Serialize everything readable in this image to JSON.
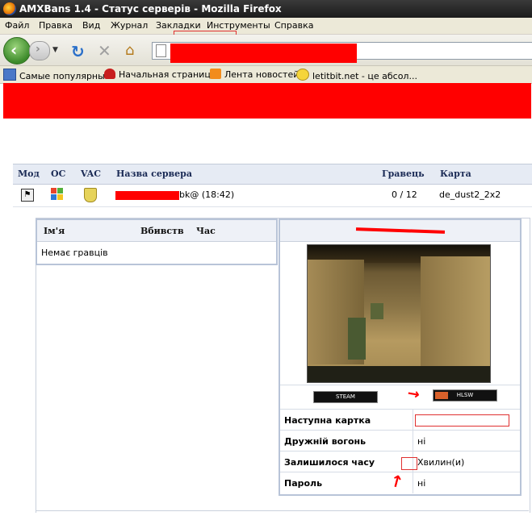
{
  "window": {
    "title": "AMXBans 1.4 - Статус серверів - Mozilla Firefox"
  },
  "menu": [
    {
      "label": "Файл"
    },
    {
      "label": "Правка"
    },
    {
      "label": "Вид"
    },
    {
      "label": "Журнал"
    },
    {
      "label": "Закладки"
    },
    {
      "label": "Инструменты"
    },
    {
      "label": "Справка"
    }
  ],
  "bookmarks": [
    {
      "label": "Самые популярные",
      "icon": "bookmark-folder-icon"
    },
    {
      "label": "Начальная страница",
      "icon": "redhat-icon"
    },
    {
      "label": "Лента новостей",
      "icon": "rss-icon"
    },
    {
      "label": "letitbit.net - це абсол...",
      "icon": "smiley-icon"
    }
  ],
  "server_table": {
    "headers": {
      "mod": "Мод",
      "os": "ОС",
      "vac": "VAC",
      "name": "Назва сервера",
      "players": "Гравець",
      "map": "Карта"
    },
    "row": {
      "name_suffix": "bk@ (18:42)",
      "players": "0 / 12",
      "map": "de_dust2_2x2"
    }
  },
  "players_panel": {
    "headers": {
      "name": "Ім'я",
      "kills": "Вбивств",
      "time": "Час"
    },
    "empty_text": "Немає гравців"
  },
  "info_panel": {
    "steam_label": "STEAM",
    "hlsw_label": "HLSW",
    "rows": [
      {
        "label": "Наступна картка",
        "value": ""
      },
      {
        "label": "Дружній вогонь",
        "value": "ні"
      },
      {
        "label": "Залишилося часу",
        "value": "Хвилин(и)"
      },
      {
        "label": "Пароль",
        "value": "ні"
      }
    ]
  },
  "colors": {
    "redaction": "#ff0000",
    "header_bg": "#e6ebf4"
  }
}
